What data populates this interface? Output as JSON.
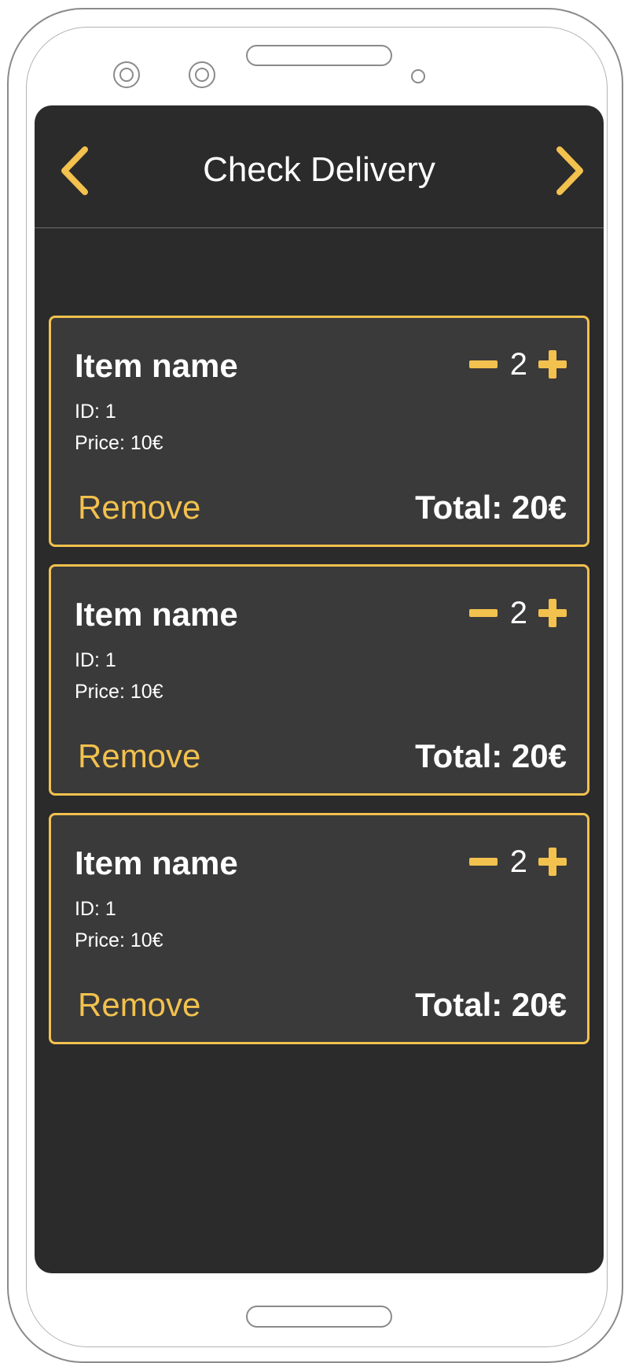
{
  "header": {
    "title": "Check Delivery",
    "back_icon": "chevron-left-icon",
    "forward_icon": "chevron-right-icon"
  },
  "colors": {
    "accent": "#f2c14e",
    "screen_bg": "#2b2b2b",
    "card_bg": "#3a3a3a",
    "text": "#ffffff"
  },
  "items": [
    {
      "name": "Item name",
      "id_text": "ID: 1",
      "price_text": "Price: 10€",
      "quantity": "2",
      "remove_label": "Remove",
      "total_text": "Total: 20€"
    },
    {
      "name": "Item name",
      "id_text": "ID: 1",
      "price_text": "Price: 10€",
      "quantity": "2",
      "remove_label": "Remove",
      "total_text": "Total: 20€"
    },
    {
      "name": "Item name",
      "id_text": "ID: 1",
      "price_text": "Price: 10€",
      "quantity": "2",
      "remove_label": "Remove",
      "total_text": "Total: 20€"
    }
  ]
}
